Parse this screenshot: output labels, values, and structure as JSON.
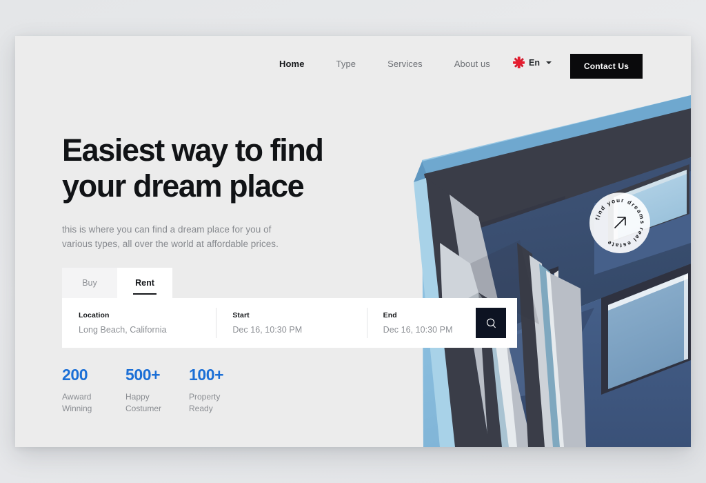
{
  "header": {
    "nav": [
      {
        "label": "Home",
        "active": true
      },
      {
        "label": "Type",
        "active": false
      },
      {
        "label": "Services",
        "active": false
      },
      {
        "label": "About us",
        "active": false
      }
    ],
    "language": {
      "label": "En",
      "flag_icon": "uk-flag-icon",
      "chevron_icon": "chevron-down-icon"
    },
    "contact_label": "Contact Us"
  },
  "hero": {
    "headline": "Easiest way to find\nyour dream place",
    "subtitle": "this is where you can find a dream place for you of\nvarious types, all over the world at affordable prices."
  },
  "badge": {
    "text": "find your dreams real estate ",
    "arrow_icon": "arrow-up-right-icon"
  },
  "search": {
    "tabs": [
      {
        "label": "Buy",
        "active": false
      },
      {
        "label": "Rent",
        "active": true
      }
    ],
    "fields": [
      {
        "label": "Location",
        "value": "Long Beach, California"
      },
      {
        "label": "Start",
        "value": "Dec 16, 10:30 PM"
      },
      {
        "label": "End",
        "value": "Dec 16, 10:30 PM"
      }
    ],
    "button_icon": "search-icon"
  },
  "stats": [
    {
      "number": "200",
      "label": "Awward\nWinning"
    },
    {
      "number": "500+",
      "label": "Happy\nCostumer"
    },
    {
      "number": "100+",
      "label": "Property\nReady"
    }
  ],
  "colors": {
    "accent_blue": "#1b6fd6",
    "dark": "#0a0a0c",
    "search_button": "#0d1322",
    "page_bg": "#ececec",
    "flag_red": "#e81c2e"
  }
}
